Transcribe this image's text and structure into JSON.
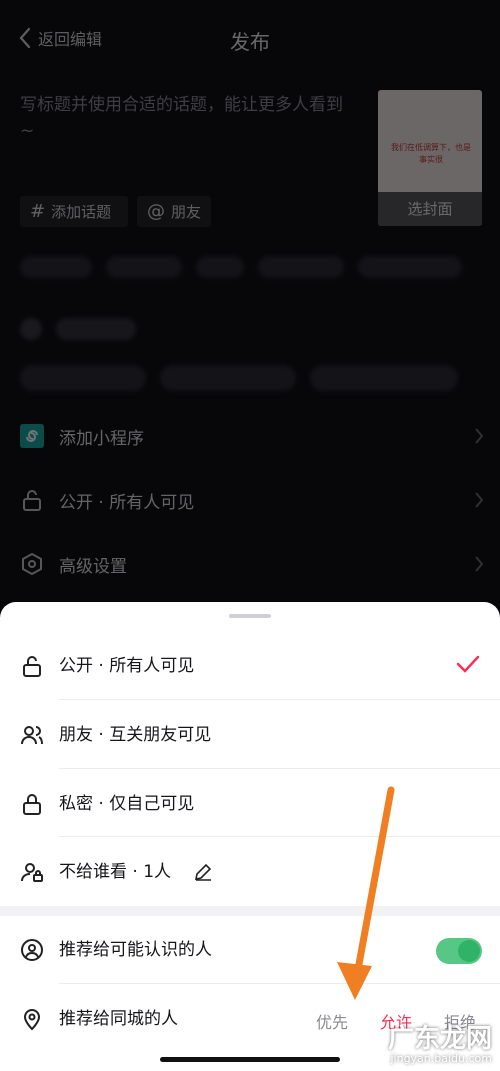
{
  "header": {
    "back_label": "返回编辑",
    "title": "发布"
  },
  "post": {
    "description_placeholder": "写标题并使用合适的话题，能让更多人看到~",
    "cover_button": "选封面",
    "cover_text": "我们在低调算下，也是事实很"
  },
  "chips": [
    {
      "icon": "#",
      "label": "添加话题"
    },
    {
      "icon": "@",
      "label": "朋友"
    }
  ],
  "menu": {
    "mini_program": "添加小程序",
    "visibility": "公开 · 所有人可见",
    "advanced": "高级设置"
  },
  "sheet": {
    "options": [
      {
        "label": "公开 · 所有人可见",
        "selected": true
      },
      {
        "label": "朋友 · 互关朋友可见",
        "selected": false
      },
      {
        "label": "私密 · 仅自己可见",
        "selected": false
      },
      {
        "label": "不给谁看 · 1人",
        "selected": false
      }
    ],
    "recommend_known": {
      "label": "推荐给可能认识的人",
      "enabled": true
    },
    "recommend_local": {
      "label": "推荐给同城的人",
      "choices": [
        "优先",
        "允许",
        "拒绝"
      ],
      "selected": "允许"
    }
  },
  "colors": {
    "accent": "#fe2c55",
    "toggle": "#30b368",
    "arrow": "#f07e22"
  },
  "watermark": {
    "title": "广东龙网",
    "url": "jingyan.baidu.com"
  }
}
